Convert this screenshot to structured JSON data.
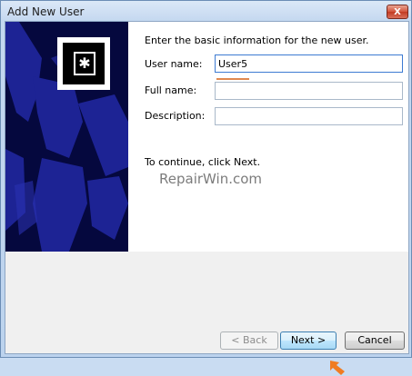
{
  "window": {
    "title": "Add New User",
    "close_label": "X"
  },
  "form": {
    "intro": "Enter the basic information for the new user.",
    "user_name_label": "User name:",
    "user_name_value": "User5",
    "full_name_label": "Full name:",
    "full_name_value": "",
    "description_label": "Description:",
    "description_value": "",
    "continue_text": "To continue, click Next."
  },
  "watermark": "RepairWin.com",
  "buttons": {
    "back": "< Back",
    "next": "Next >",
    "cancel": "Cancel"
  },
  "colors": {
    "art_bg": "#05083e",
    "annotation": "#f07c22"
  }
}
